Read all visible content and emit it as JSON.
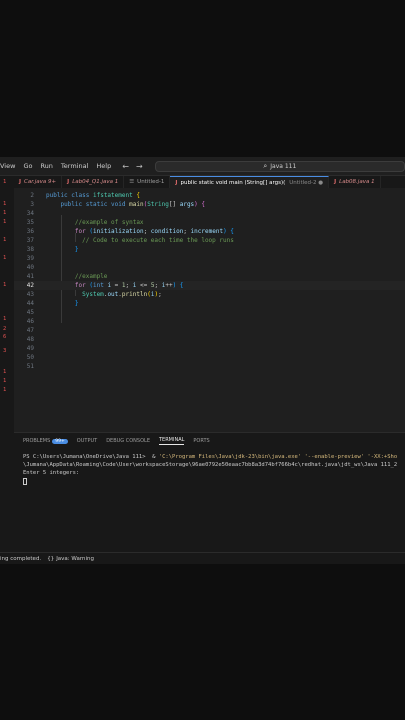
{
  "menu": [
    "View",
    "Go",
    "Run",
    "Terminal",
    "Help"
  ],
  "nav": {
    "back": "←",
    "forward": "→"
  },
  "search": {
    "icon": "search-icon",
    "text": "Java 111"
  },
  "tabs": [
    {
      "icon": "J",
      "label": "Car.java 9+",
      "italic": true
    },
    {
      "icon": "J",
      "label": "Lab04_Q1.java 1",
      "italic": true
    },
    {
      "icon": "☰",
      "label": "Untitled-1",
      "italic": false
    },
    {
      "icon": "J",
      "label": "public static void main (String[] args)(",
      "italic": false,
      "active": true,
      "suffix": "Untitled-2 ●"
    },
    {
      "icon": "J",
      "label": "Lab08.java 1",
      "italic": true
    }
  ],
  "activity_numbers": [
    {
      "top": "1"
    },
    {
      "top": "1"
    },
    {
      "top": "1"
    },
    {
      "top": "1"
    },
    {
      "top": "1"
    },
    {
      "top": "1"
    },
    {
      "top": "1"
    },
    {
      "top": "1"
    },
    {
      "top": "2"
    },
    {
      "top": "6"
    },
    {
      "top": "3"
    },
    {
      "top": "1"
    },
    {
      "top": "1"
    },
    {
      "top": "1"
    }
  ],
  "editor": {
    "lines": [
      {
        "n": "2",
        "tokens": [
          [
            "kw",
            "public "
          ],
          [
            "kw",
            "class "
          ],
          [
            "ty",
            "ifstatement "
          ],
          [
            "br1",
            "{"
          ]
        ]
      },
      {
        "n": "3",
        "tokens": [
          [
            "",
            "    "
          ],
          [
            "kw",
            "public "
          ],
          [
            "kw",
            "static "
          ],
          [
            "kw",
            "void "
          ],
          [
            "fn",
            "main"
          ],
          [
            "br2",
            "("
          ],
          [
            "ty",
            "String"
          ],
          [
            "",
            "[] "
          ],
          [
            "var",
            "args"
          ],
          [
            "br2",
            ") "
          ],
          [
            "br2",
            "{"
          ]
        ]
      },
      {
        "n": "34",
        "tokens": []
      },
      {
        "n": "35",
        "tokens": [
          [
            "",
            "        "
          ],
          [
            "cm",
            "//example of syntax"
          ]
        ]
      },
      {
        "n": "36",
        "tokens": [
          [
            "",
            "        "
          ],
          [
            "ctl",
            "for "
          ],
          [
            "br3",
            "("
          ],
          [
            "var",
            "initialization"
          ],
          [
            "",
            "; "
          ],
          [
            "var",
            "condition"
          ],
          [
            "",
            "; "
          ],
          [
            "var",
            "increment"
          ],
          [
            "br3",
            ") "
          ],
          [
            "br3",
            "{"
          ]
        ]
      },
      {
        "n": "37",
        "tokens": [
          [
            "",
            "          "
          ],
          [
            "cm",
            "// Code to execute each time the loop runs"
          ]
        ]
      },
      {
        "n": "38",
        "tokens": [
          [
            "",
            "        "
          ],
          [
            "br3",
            "}"
          ]
        ]
      },
      {
        "n": "39",
        "tokens": []
      },
      {
        "n": "40",
        "tokens": []
      },
      {
        "n": "41",
        "tokens": [
          [
            "",
            "        "
          ],
          [
            "cm",
            "//example"
          ]
        ]
      },
      {
        "n": "42",
        "tokens": [
          [
            "",
            "        "
          ],
          [
            "ctl",
            "for "
          ],
          [
            "br3",
            "("
          ],
          [
            "kw",
            "int "
          ],
          [
            "var",
            "i "
          ],
          [
            "",
            "= "
          ],
          [
            "num",
            "1"
          ],
          [
            "",
            "; "
          ],
          [
            "var",
            "i "
          ],
          [
            "",
            "<= "
          ],
          [
            "num",
            "5"
          ],
          [
            "",
            "; "
          ],
          [
            "var",
            "i"
          ],
          [
            "",
            "++"
          ],
          [
            "br3",
            ") "
          ],
          [
            "br3",
            "{"
          ]
        ],
        "current": true
      },
      {
        "n": "43",
        "tokens": [
          [
            "",
            "          "
          ],
          [
            "ty",
            "System"
          ],
          [
            "",
            "."
          ],
          [
            "var",
            "out"
          ],
          [
            "",
            "."
          ],
          [
            "fn",
            "println"
          ],
          [
            "br1",
            "("
          ],
          [
            "var",
            "i"
          ],
          [
            "br1",
            ")"
          ],
          [
            ";",
            ";"
          ]
        ]
      },
      {
        "n": "44",
        "tokens": [
          [
            "",
            "        "
          ],
          [
            "br3",
            "}"
          ]
        ]
      },
      {
        "n": "45",
        "tokens": []
      },
      {
        "n": "46",
        "tokens": []
      },
      {
        "n": "47",
        "tokens": []
      },
      {
        "n": "48",
        "tokens": []
      },
      {
        "n": "49",
        "tokens": []
      },
      {
        "n": "50",
        "tokens": []
      },
      {
        "n": "51",
        "tokens": []
      }
    ]
  },
  "panel": {
    "tabs": [
      {
        "label": "PROBLEMS",
        "badge": "99+"
      },
      {
        "label": "OUTPUT"
      },
      {
        "label": "DEBUG CONSOLE"
      },
      {
        "label": "TERMINAL",
        "active": true
      },
      {
        "label": "PORTS"
      }
    ]
  },
  "terminal": {
    "line1_prompt": "PS C:\\Users\\Jumana\\OneDrive\\Java 111>  & ",
    "line1_cmd": "'C:\\Program Files\\Java\\jdk-23\\bin\\java.exe' '--enable-preview' '-XX:+Sho",
    "line2": "\\Jumana\\AppData\\Roaming\\Code\\User\\workspaceStorage\\96ae0792e50eaac7bb8a3d74bf766b4c\\redhat.java\\jdt_ws\\Java 111_2",
    "line3": "Enter 5 integers:"
  },
  "status": {
    "left": "ing completed.",
    "warning_icon": "braces-icon",
    "warning": "Java: Warning"
  }
}
